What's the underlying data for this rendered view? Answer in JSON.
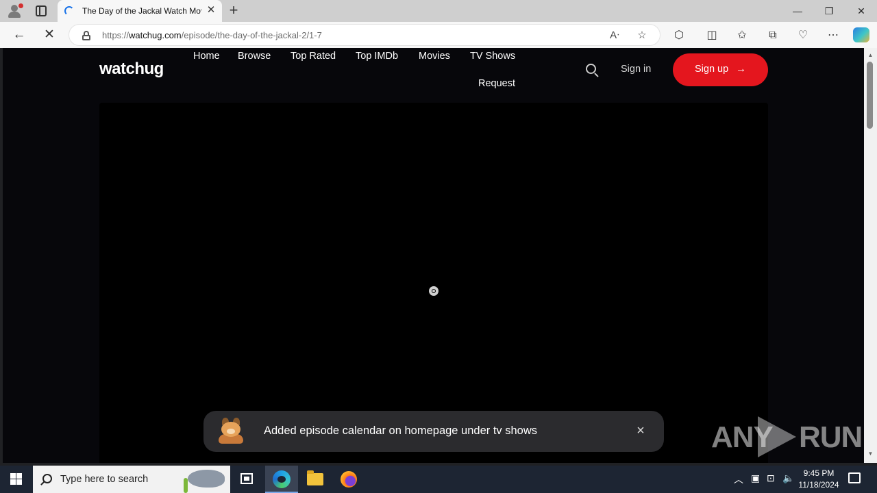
{
  "browser": {
    "tab": {
      "title": "The Day of the Jackal Watch Movie"
    },
    "address": {
      "scheme": "https://",
      "host": "watchug.com",
      "path": "/episode/the-day-of-the-jackal-2/1-7"
    }
  },
  "site": {
    "logo": "watchug",
    "nav": [
      "Home",
      "Browse",
      "Top Rated",
      "Top IMDb",
      "Movies",
      "TV Shows",
      "Request"
    ],
    "signin_label": "Sign in",
    "signup_label": "Sign up",
    "signup_arrow": "→"
  },
  "toast": {
    "message": "Added episode calendar on homepage under tv shows",
    "close": "×"
  },
  "watermark": {
    "left": "ANY",
    "right": "RUN"
  },
  "taskbar": {
    "search_placeholder": "Type here to search",
    "time": "9:45 PM",
    "date": "11/18/2024"
  },
  "colors": {
    "page_bg": "#07070b",
    "signup_bg": "#e4161e",
    "toast_bg": "#2b2b2e",
    "taskbar_bg": "#1d2533"
  },
  "icons": [
    "profile-icon",
    "tab-actions-icon",
    "loading-spinner-icon",
    "close-tab-icon",
    "new-tab-icon",
    "minimize-icon",
    "restore-icon",
    "close-window-icon",
    "back-icon",
    "stop-icon",
    "lock-icon",
    "read-aloud-icon",
    "favorite-star-icon",
    "extensions-icon",
    "split-screen-icon",
    "favorites-icon",
    "collections-icon",
    "browser-essentials-icon",
    "more-icon",
    "copilot-icon",
    "search-icon",
    "arrow-right-icon",
    "player-loader-icon",
    "mascot-icon",
    "close-icon",
    "windows-start-icon",
    "task-view-icon",
    "edge-icon",
    "file-explorer-icon",
    "firefox-icon",
    "tray-chevron-icon",
    "network-icon",
    "volume-icon",
    "notification-icon"
  ]
}
